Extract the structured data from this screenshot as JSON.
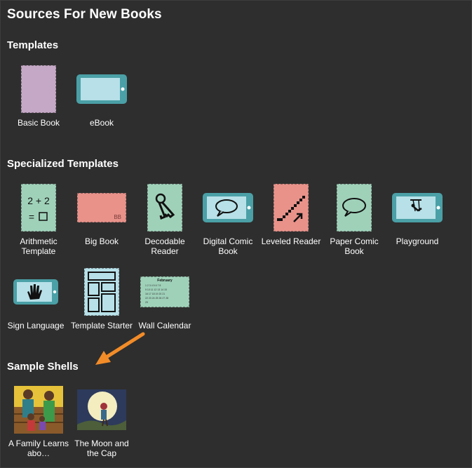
{
  "title": "Sources For New Books",
  "sections": {
    "templates": {
      "heading": "Templates",
      "items": [
        {
          "label": "Basic Book"
        },
        {
          "label": "eBook"
        }
      ]
    },
    "specialized": {
      "heading": "Specialized Templates",
      "items": [
        {
          "label": "Arithmetic Template",
          "thumb_text": "2 + 2\n= □"
        },
        {
          "label": "Big Book",
          "thumb_text": "BB"
        },
        {
          "label": "Decodable Reader"
        },
        {
          "label": "Digital Comic Book"
        },
        {
          "label": "Leveled Reader"
        },
        {
          "label": "Paper Comic Book"
        },
        {
          "label": "Playground"
        },
        {
          "label": "Sign Language"
        },
        {
          "label": "Template Starter"
        },
        {
          "label": "Wall Calendar",
          "thumb_text": "February"
        }
      ]
    },
    "shells": {
      "heading": "Sample Shells",
      "items": [
        {
          "label": "A Family Learns abo…"
        },
        {
          "label": "The Moon and the Cap"
        }
      ]
    }
  },
  "colors": {
    "background": "#2e2e2e",
    "purple_book": "#c5a8c6",
    "teal_device": "#4aa0a6",
    "light_blue": "#b7e0e8",
    "mint": "#9fd1b9",
    "salmon": "#e8928a",
    "arrow_orange": "#f28c28"
  }
}
